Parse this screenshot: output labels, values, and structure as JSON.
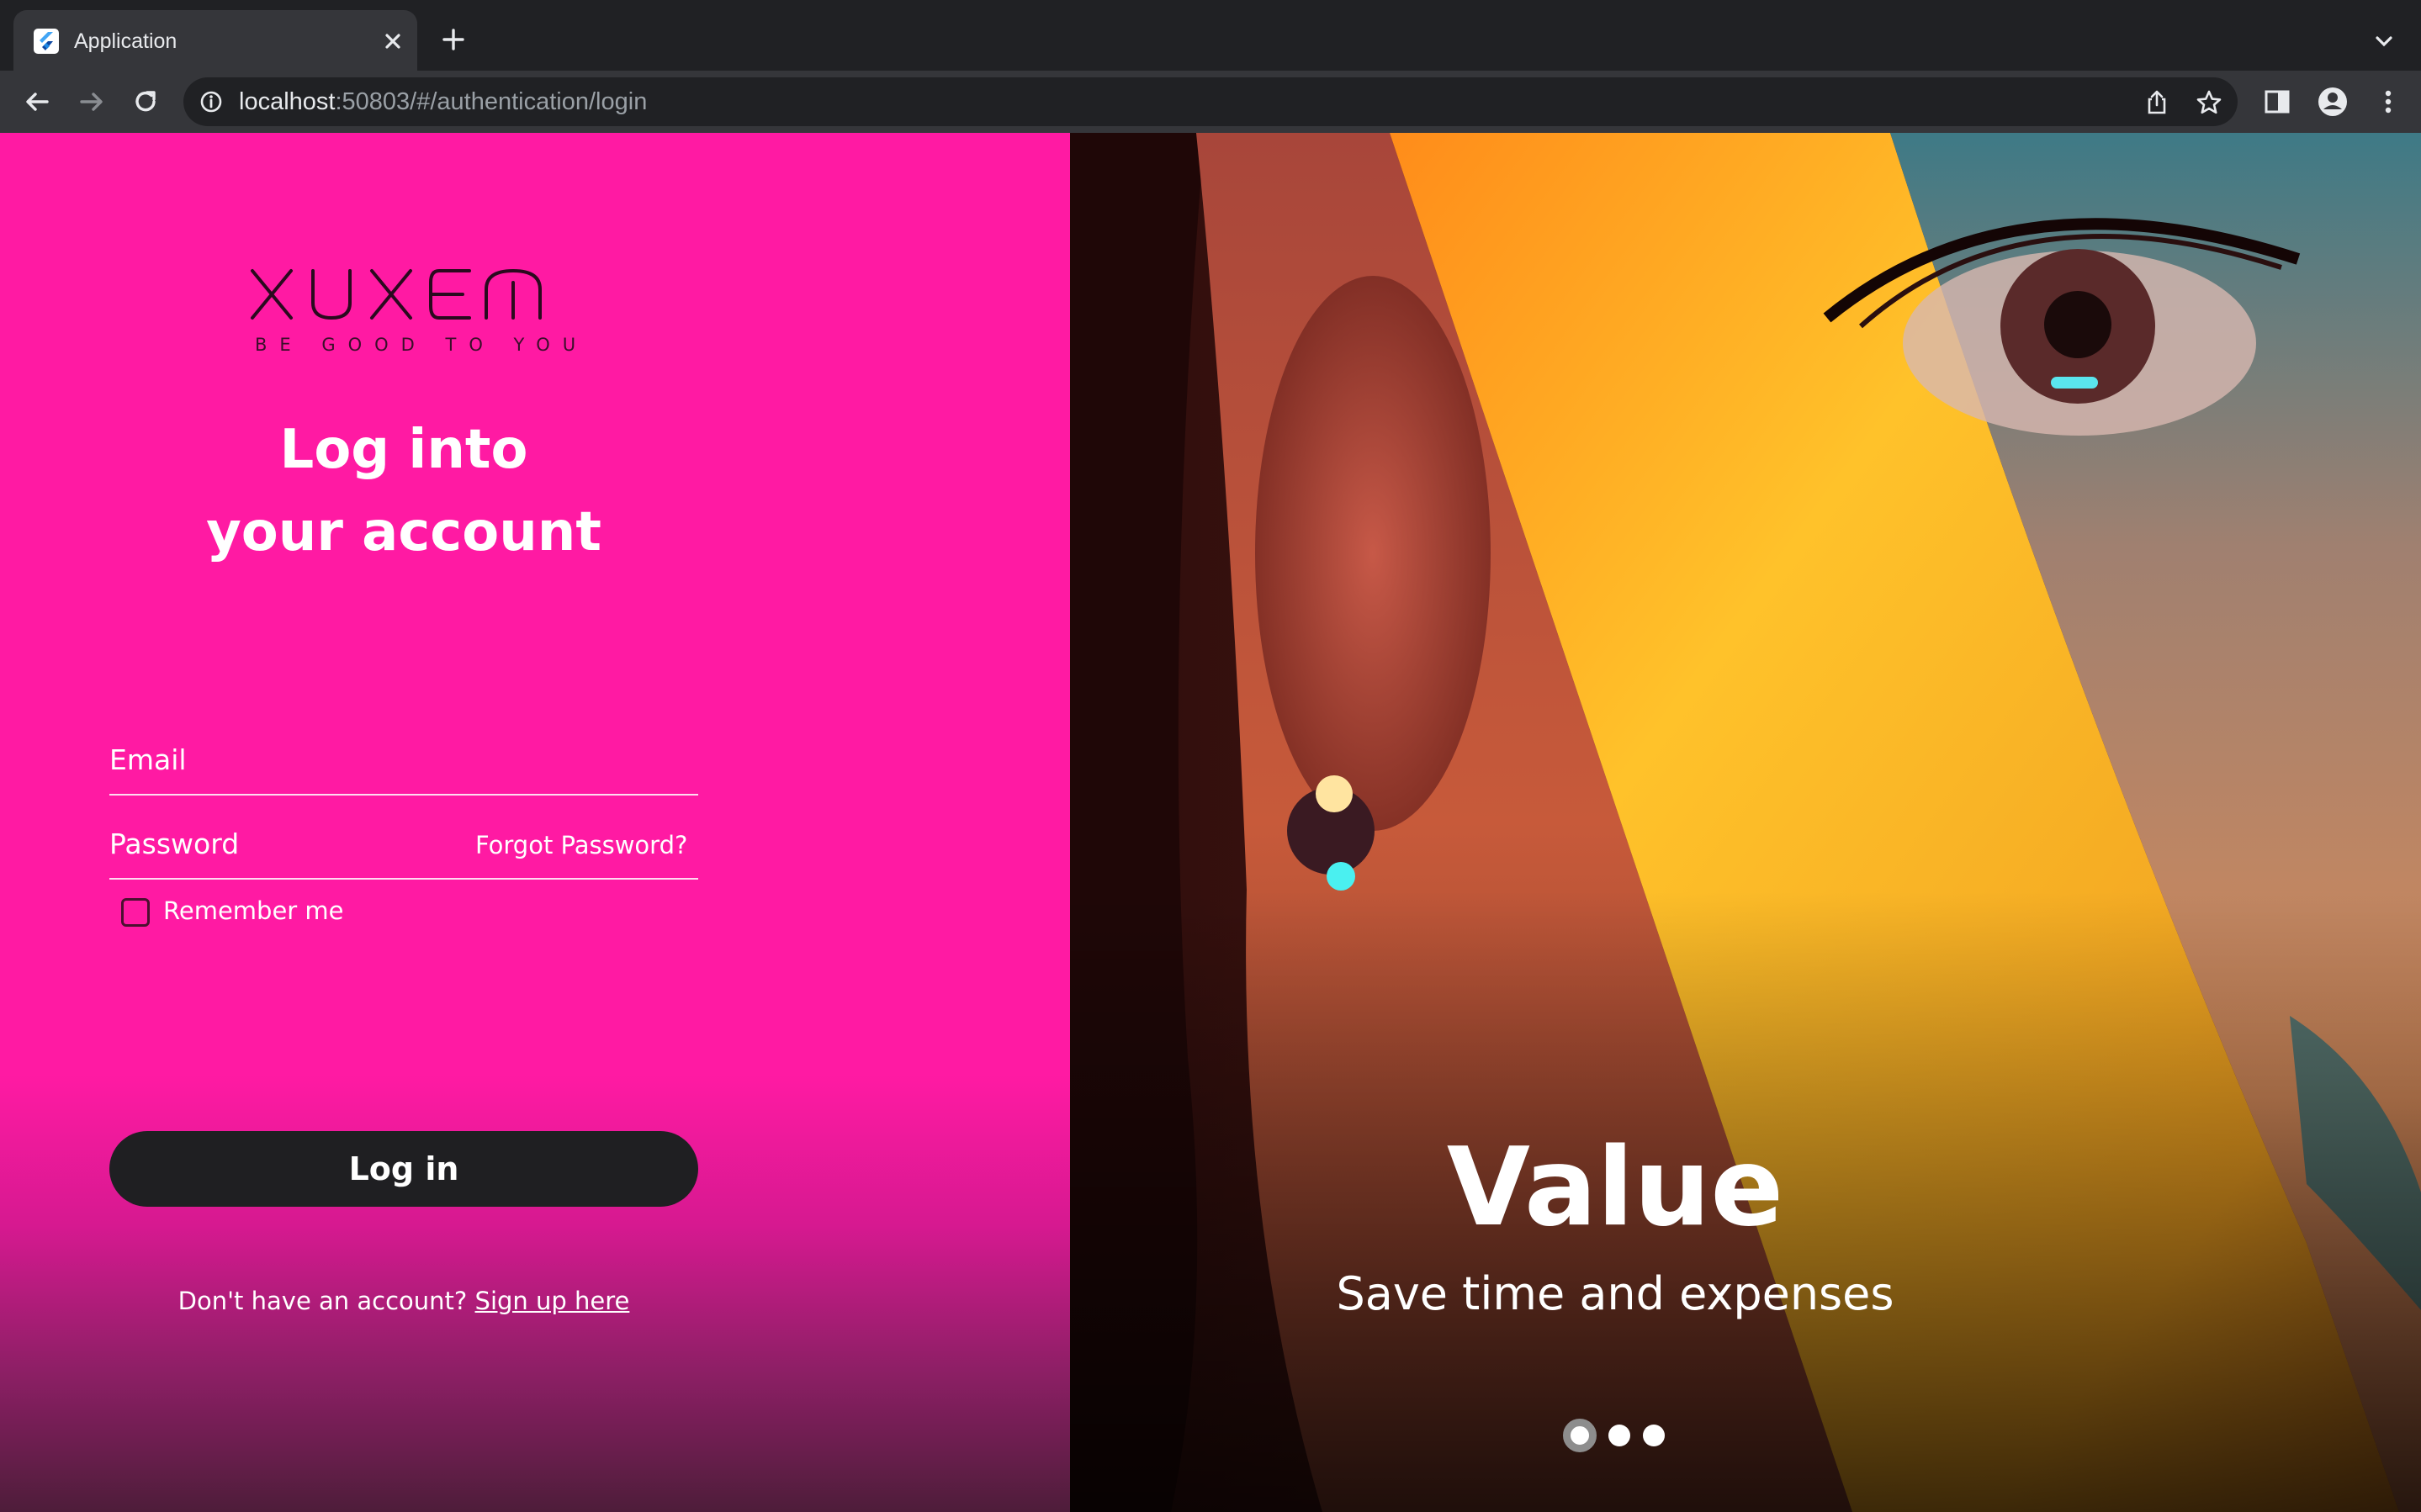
{
  "browser": {
    "tab_title": "Application",
    "url_host": "localhost",
    "url_path": ":50803/#/authentication/login",
    "icons": [
      "flutter-favicon-icon",
      "close-icon",
      "plus-icon",
      "chevron-down-icon",
      "back-arrow-icon",
      "forward-arrow-icon",
      "reload-icon",
      "info-icon",
      "share-icon",
      "star-icon",
      "side-panel-icon",
      "profile-icon",
      "kebab-menu-icon"
    ]
  },
  "login": {
    "logo_word": "XUXEM",
    "logo_tagline": "BE GOOD TO YOU",
    "heading_line1": "Log into",
    "heading_line2": "your account",
    "email_placeholder": "Email",
    "password_placeholder": "Password",
    "forgot_password": "Forgot Password?",
    "remember_me": "Remember me",
    "remember_checked": false,
    "login_button": "Log in",
    "no_account_text": "Don't have an account? ",
    "signup_link": "Sign up here"
  },
  "carousel": {
    "title": "Value",
    "subtitle": "Save time and expenses",
    "slide_count": 3,
    "active_index": 0
  },
  "colors": {
    "accent_pink": "#ff1aa3",
    "button_dark": "#1f1f22",
    "stripe_yellow": "#ffb726",
    "chrome_dark": "#202124"
  }
}
